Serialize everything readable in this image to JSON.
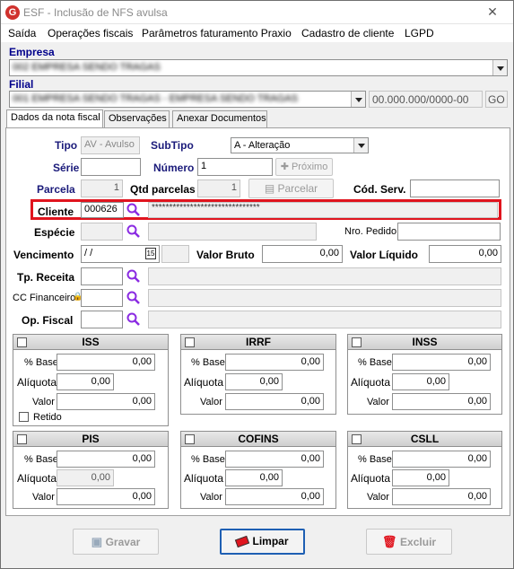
{
  "window": {
    "title": "ESF - Inclusão de NFS avulsa",
    "logo_letter": "G",
    "close_glyph": "✕"
  },
  "menu": [
    "Saída",
    "Operações fiscais",
    "Parâmetros faturamento Praxio",
    "Cadastro de cliente",
    "LGPD"
  ],
  "empresa": {
    "label": "Empresa",
    "value": "002 EMPRESA SENDO TRAGAS"
  },
  "filial": {
    "label": "Filial",
    "value": "001 EMPRESA SENDO TRAGAS - EMPRESA SENDO TRAGAS",
    "cnpj": "00.000.000/0000-00",
    "uf": "GO"
  },
  "tabs": [
    "Dados da nota fiscal",
    "Observações",
    "Anexar Documentos"
  ],
  "form": {
    "tipo_label": "Tipo",
    "tipo_value": "AV - Avulso",
    "subtipo_label": "SubTipo",
    "subtipo_value": "A - Alteração",
    "serie_label": "Série",
    "serie_value": "",
    "numero_label": "Número",
    "numero_value": "1",
    "proximo_label": "Próximo",
    "parcela_label": "Parcela",
    "parcela_value": "1",
    "qtd_parcelas_label": "Qtd parcelas",
    "qtd_parcelas_value": "1",
    "parcelar_label": "Parcelar",
    "cod_serv_label": "Cód. Serv.",
    "cod_serv_value": "",
    "cliente_label": "Cliente",
    "cliente_code": "000626",
    "cliente_name": "*******************************",
    "especie_label": "Espécie",
    "nro_pedido_label": "Nro. Pedido",
    "vencimento_label": "Vencimento",
    "vencimento_value": " / /",
    "calendar_glyph": "15",
    "valor_bruto_label": "Valor Bruto",
    "valor_bruto_value": "0,00",
    "valor_liquido_label": "Valor Líquido",
    "valor_liquido_value": "0,00",
    "tp_receita_label": "Tp. Receita",
    "cc_financeiro_label": "CC Financeiro",
    "op_fiscal_label": "Op. Fiscal"
  },
  "taxes": [
    {
      "name": "ISS",
      "base_label": "% Base",
      "base": "0,00",
      "aliquota_label": "Alíquota",
      "aliquota": "0,00",
      "valor_label": "Valor",
      "valor": "0,00",
      "retido_label": "Retido"
    },
    {
      "name": "IRRF",
      "base_label": "% Base",
      "base": "0,00",
      "aliquota_label": "Alíquota",
      "aliquota": "0,00",
      "valor_label": "Valor",
      "valor": "0,00"
    },
    {
      "name": "INSS",
      "base_label": "% Base",
      "base": "0,00",
      "aliquota_label": "Alíquota",
      "aliquota": "0,00",
      "valor_label": "Valor",
      "valor": "0,00"
    },
    {
      "name": "PIS",
      "base_label": "% Base",
      "base": "0,00",
      "aliquota_label": "Alíquota",
      "aliquota": "0,00",
      "valor_label": "Valor",
      "valor": "0,00"
    },
    {
      "name": "COFINS",
      "base_label": "% Base",
      "base": "0,00",
      "aliquota_label": "Alíquota",
      "aliquota": "0,00",
      "valor_label": "Valor",
      "valor": "0,00"
    },
    {
      "name": "CSLL",
      "base_label": "% Base",
      "base": "0,00",
      "aliquota_label": "Alíquota",
      "aliquota": "0,00",
      "valor_label": "Valor",
      "valor": "0,00"
    }
  ],
  "buttons": {
    "gravar": "Gravar",
    "limpar": "Limpar",
    "excluir": "Excluir"
  },
  "colors": {
    "highlight": "#e0141e",
    "search": "#8a2be2",
    "label_blue": "#1a1a7a"
  }
}
